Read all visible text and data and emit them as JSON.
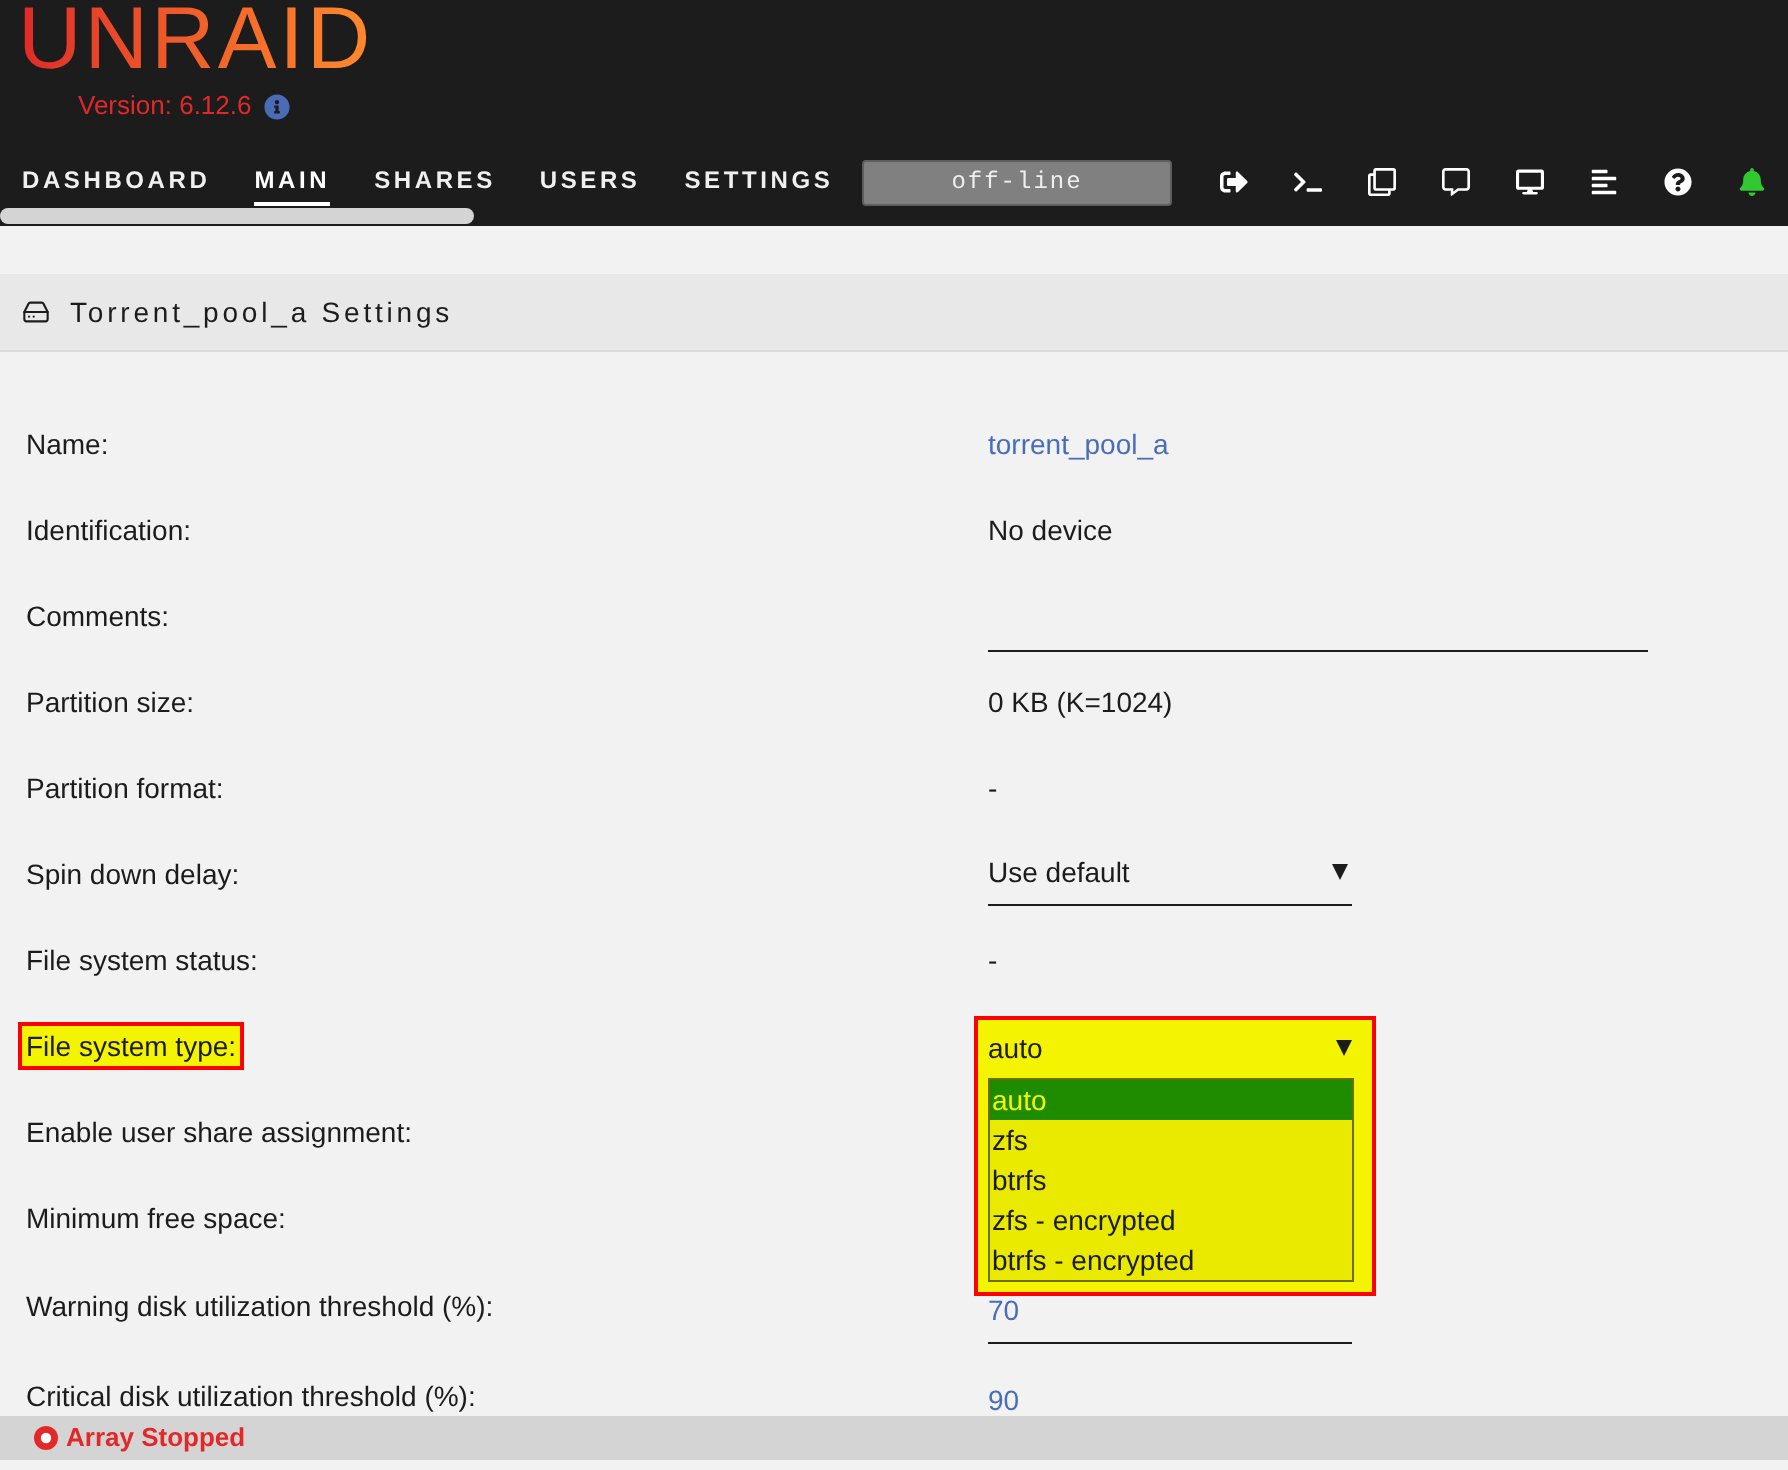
{
  "header": {
    "logo": "UNRAID",
    "version": "Version: 6.12.6"
  },
  "nav": {
    "items": [
      {
        "label": "DASHBOARD",
        "selected": false
      },
      {
        "label": "MAIN",
        "selected": true
      },
      {
        "label": "SHARES",
        "selected": false
      },
      {
        "label": "USERS",
        "selected": false
      },
      {
        "label": "SETTINGS",
        "selected": false
      }
    ],
    "status": "off-line"
  },
  "section": {
    "title": "Torrent_pool_a Settings"
  },
  "fields": [
    {
      "label": "Name:",
      "kind": "link",
      "value": "torrent_pool_a",
      "highlighted": false
    },
    {
      "label": "Identification:",
      "kind": "text",
      "value": "No device",
      "highlighted": false
    },
    {
      "label": "Comments:",
      "kind": "input",
      "highlighted": false
    },
    {
      "label": "Partition size:",
      "kind": "text",
      "value": "0 KB (K=1024)",
      "highlighted": false
    },
    {
      "label": "Partition format:",
      "kind": "text",
      "value": "-",
      "highlighted": false
    },
    {
      "label": "Spin down delay:",
      "kind": "select",
      "value": "Use default",
      "highlighted": false
    },
    {
      "label": "File system status:",
      "kind": "text",
      "value": "-",
      "highlighted": false
    },
    {
      "label": "File system type:",
      "kind": "dropdown",
      "value": "auto",
      "highlighted": true,
      "options": [
        {
          "label": "auto",
          "selected": true
        },
        {
          "label": "zfs",
          "selected": false
        },
        {
          "label": "btrfs",
          "selected": false
        },
        {
          "label": "zfs - encrypted",
          "selected": false
        },
        {
          "label": "btrfs - encrypted",
          "selected": false
        }
      ]
    },
    {
      "label": "Enable user share assignment:",
      "kind": "empty",
      "highlighted": false
    },
    {
      "label": "Minimum free space:",
      "kind": "empty",
      "highlighted": false
    },
    {
      "label": "Warning disk utilization threshold (%):",
      "kind": "number",
      "value": "70",
      "highlighted": false
    },
    {
      "label": "Critical disk utilization threshold (%):",
      "kind": "number",
      "value": "90",
      "highlighted": false
    }
  ],
  "status_bar": {
    "text": "Array Stopped"
  }
}
